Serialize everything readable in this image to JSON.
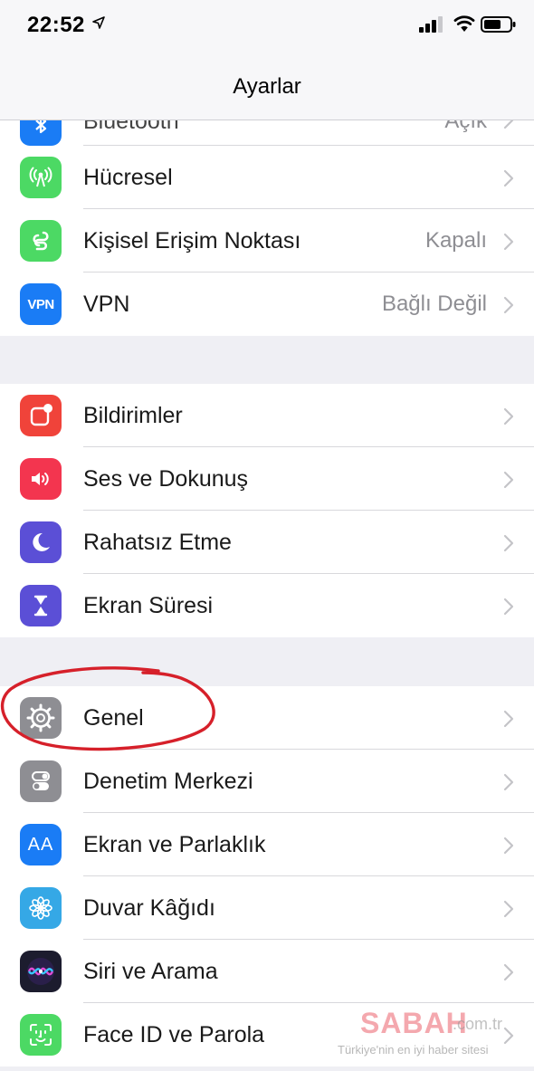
{
  "status_bar": {
    "time": "22:52"
  },
  "nav": {
    "title": "Ayarlar"
  },
  "groups": [
    {
      "rows": [
        {
          "label": "Bluetooth",
          "value": "Açık",
          "icon": "bluetooth-icon",
          "color": "#1a7cf5"
        },
        {
          "label": "Hücresel",
          "value": "",
          "icon": "antenna-icon",
          "color": "#4cd964"
        },
        {
          "label": "Kişisel Erişim Noktası",
          "value": "Kapalı",
          "icon": "hotspot-icon",
          "color": "#4cd964"
        },
        {
          "label": "VPN",
          "value": "Bağlı Değil",
          "icon": "vpn-icon",
          "color": "#1a7cf5",
          "icon_text": "VPN"
        }
      ]
    },
    {
      "rows": [
        {
          "label": "Bildirimler",
          "value": "",
          "icon": "notifications-icon",
          "color": "#f0433a"
        },
        {
          "label": "Ses ve Dokunuş",
          "value": "",
          "icon": "speaker-icon",
          "color": "#f3354f"
        },
        {
          "label": "Rahatsız Etme",
          "value": "",
          "icon": "moon-icon",
          "color": "#5b4fd6"
        },
        {
          "label": "Ekran Süresi",
          "value": "",
          "icon": "hourglass-icon",
          "color": "#5b4fd6"
        }
      ]
    },
    {
      "rows": [
        {
          "label": "Genel",
          "value": "",
          "icon": "gear-icon",
          "color": "#8e8e93"
        },
        {
          "label": "Denetim Merkezi",
          "value": "",
          "icon": "toggles-icon",
          "color": "#8e8e93"
        },
        {
          "label": "Ekran ve Parlaklık",
          "value": "",
          "icon": "text-size-icon",
          "color": "#1a7cf5",
          "icon_text": "AA"
        },
        {
          "label": "Duvar Kâğıdı",
          "value": "",
          "icon": "flower-icon",
          "color": "#35a8e6"
        },
        {
          "label": "Siri ve Arama",
          "value": "",
          "icon": "siri-icon",
          "color": "#1c1c2e"
        },
        {
          "label": "Face ID ve Parola",
          "value": "",
          "icon": "face-id-icon",
          "color": "#4cd964"
        }
      ]
    }
  ],
  "watermark": {
    "brand": "SABAH",
    "domain": ".com.tr",
    "tagline": "Türkiye'nin en iyi haber sitesi"
  }
}
